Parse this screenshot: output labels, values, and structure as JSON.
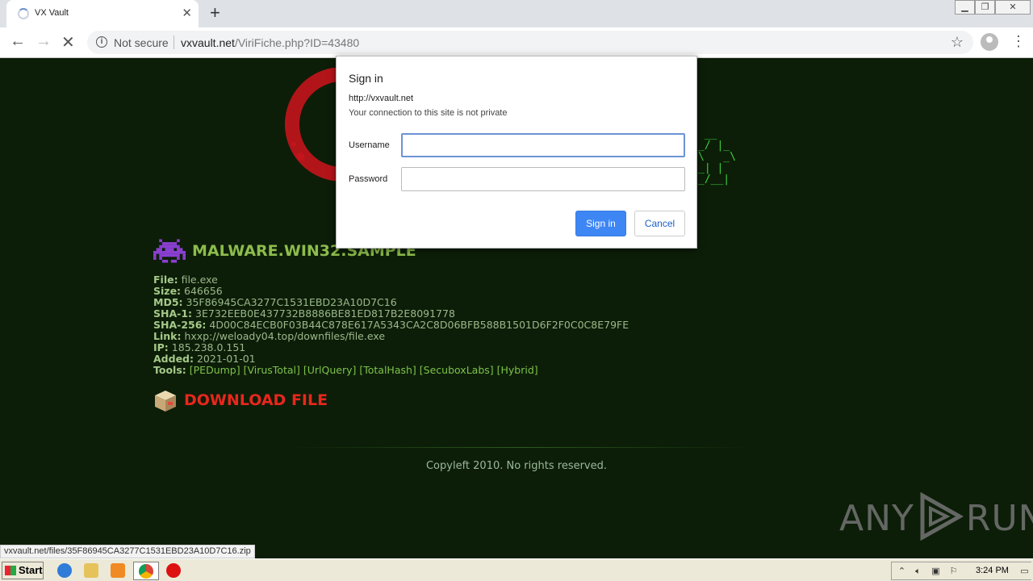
{
  "browser": {
    "tab_title": "VX Vault",
    "tab_close": "✕",
    "new_tab": "+",
    "security_label": "Not secure",
    "url_host": "vxvault.net",
    "url_path": "/ViriFiche.php?ID=43480"
  },
  "page": {
    "ascii_art": " __\n_/ |_\n\\   _\\\n_| |\n_/__|",
    "sample_title": "MALWARE.WIN32.SAMPLE",
    "fields": [
      {
        "label": "File:",
        "value": "file.exe"
      },
      {
        "label": "Size:",
        "value": "646656"
      },
      {
        "label": "MD5:",
        "value": "35F86945CA3277C1531EBD23A10D7C16"
      },
      {
        "label": "SHA-1:",
        "value": "3E732EEB0E437732B8886BE81ED817B2E8091778"
      },
      {
        "label": "SHA-256:",
        "value": "4D00C84ECB0F03B44C878E617A5343CA2C8D06BFB588B1501D6F2F0C0C8E79FE"
      },
      {
        "label": "Link:",
        "value": "hxxp://weloady04.top/downfiles/file.exe"
      },
      {
        "label": "IP:",
        "value": "185.238.0.151"
      },
      {
        "label": "Added:",
        "value": "2021-01-01"
      }
    ],
    "tools_label": "Tools:",
    "tools": [
      "[PEDump]",
      "[VirusTotal]",
      "[UrlQuery]",
      "[TotalHash]",
      "[SecuboxLabs]",
      "[Hybrid]"
    ],
    "download_label": "DOWNLOAD FILE",
    "copyleft": "Copyleft 2010. No rights reserved.",
    "watermark_left": "ANY",
    "watermark_right": "RUN"
  },
  "status_url": "vxvault.net/files/35F86945CA3277C1531EBD23A10D7C16.zip",
  "dialog": {
    "title": "Sign in",
    "host": "http://vxvault.net",
    "subtitle": "Your connection to this site is not private",
    "username_label": "Username",
    "password_label": "Password",
    "username_value": "",
    "password_value": "",
    "signin_label": "Sign in",
    "cancel_label": "Cancel"
  },
  "taskbar": {
    "start_label": "Start",
    "clock": "3:24 PM"
  },
  "colors": {
    "page_bg": "#0c1e08",
    "title_green": "#8dbc4c",
    "download_red": "#e8271d",
    "signin_blue": "#3d86f4"
  }
}
